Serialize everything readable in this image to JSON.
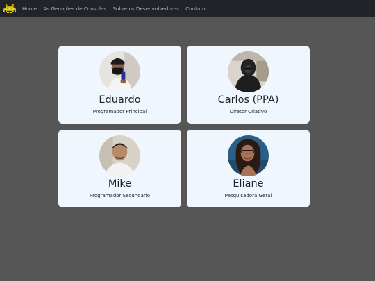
{
  "nav": {
    "brand_icon": "space-invader-icon",
    "links": [
      "Home.",
      "As Gerações de Consoles.",
      "Sobre os Desenvolvedores.",
      "Contato."
    ]
  },
  "team": [
    {
      "name": "Eduardo",
      "role": "Programador Principal"
    },
    {
      "name": "Carlos (PPA)",
      "role": "Diretor Criativo"
    },
    {
      "name": "Mike",
      "role": "Programador Secundario"
    },
    {
      "name": "Eliane",
      "role": "Pesquisadora Geral"
    }
  ],
  "colors": {
    "navbar": "#212529",
    "background": "#565656",
    "card": "#eff6fd"
  }
}
